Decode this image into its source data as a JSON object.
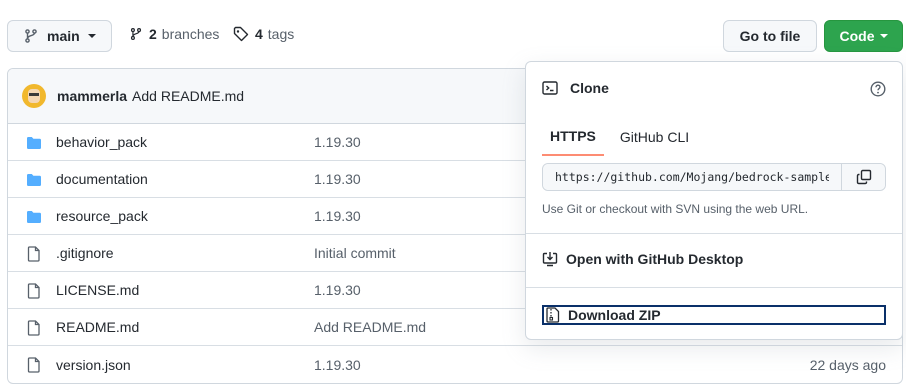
{
  "branch": {
    "name": "main",
    "branches_count": "2",
    "branches_label": "branches",
    "tags_count": "4",
    "tags_label": "tags"
  },
  "buttons": {
    "go_to_file": "Go to file",
    "code": "Code"
  },
  "commit": {
    "author": "mammerla",
    "message": "Add README.md"
  },
  "files": [
    {
      "name": "behavior_pack",
      "type": "dir",
      "message": "1.19.30",
      "age": ""
    },
    {
      "name": "documentation",
      "type": "dir",
      "message": "1.19.30",
      "age": ""
    },
    {
      "name": "resource_pack",
      "type": "dir",
      "message": "1.19.30",
      "age": ""
    },
    {
      "name": ".gitignore",
      "type": "file",
      "message": "Initial commit",
      "age": ""
    },
    {
      "name": "LICENSE.md",
      "type": "file",
      "message": "1.19.30",
      "age": ""
    },
    {
      "name": "README.md",
      "type": "file",
      "message": "Add README.md",
      "age": ""
    },
    {
      "name": "version.json",
      "type": "file",
      "message": "1.19.30",
      "age": "22 days ago"
    }
  ],
  "clone": {
    "title": "Clone",
    "tabs": [
      "HTTPS",
      "GitHub CLI"
    ],
    "url": "https://github.com/Mojang/bedrock-samples",
    "hint": "Use Git or checkout with SVN using the web URL.",
    "open_desktop": "Open with GitHub Desktop",
    "download_zip": "Download ZIP"
  },
  "colors": {
    "code_button": "#2da44e",
    "folder_icon": "#54aeff",
    "active_tab": "#fd8c73"
  }
}
